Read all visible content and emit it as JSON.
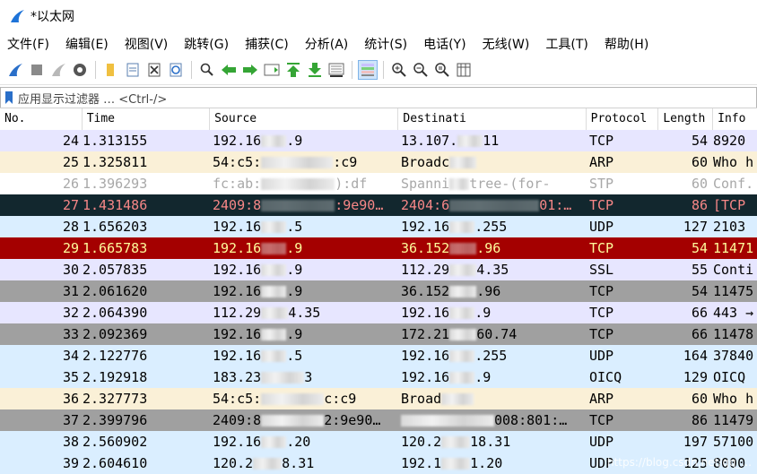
{
  "window": {
    "title": "*以太网"
  },
  "menu": [
    "文件(F)",
    "编辑(E)",
    "视图(V)",
    "跳转(G)",
    "捕获(C)",
    "分析(A)",
    "统计(S)",
    "电话(Y)",
    "无线(W)",
    "工具(T)",
    "帮助(H)"
  ],
  "filter": {
    "placeholder": "应用显示过滤器 … <Ctrl-/>"
  },
  "columns": {
    "no": "No.",
    "time": "Time",
    "source": "Source",
    "destination": "Destinati",
    "protocol": "Protocol",
    "length": "Length",
    "info": "Info"
  },
  "packets": [
    {
      "no": "24",
      "time": "1.313155",
      "src": "192.16",
      "src2": ".9",
      "dst": "13.107.",
      "dst2": "11",
      "proto": "TCP",
      "len": "54",
      "info": "8920"
    },
    {
      "no": "25",
      "time": "1.325811",
      "src": "54:c5:",
      "src2": ":c9",
      "dst": "Broadc",
      "dst2": "",
      "proto": "ARP",
      "len": "60",
      "info": "Who h"
    },
    {
      "no": "26",
      "time": "1.396293",
      "src": "fc:ab:",
      "src2": "):df",
      "dst": "Spanni",
      "dst2": "tree-(for-",
      "proto": "STP",
      "len": "60",
      "info": "Conf."
    },
    {
      "no": "27",
      "time": "1.431486",
      "src": "2409:8",
      "src2": ":9e90…",
      "dst": "2404:6",
      "dst2": "01:…",
      "proto": "TCP",
      "len": "86",
      "info": "[TCP"
    },
    {
      "no": "28",
      "time": "1.656203",
      "src": "192.16",
      "src2": ".5",
      "dst": "192.16",
      "dst2": ".255",
      "proto": "UDP",
      "len": "127",
      "info": "2103"
    },
    {
      "no": "29",
      "time": "1.665783",
      "src": "192.16",
      "src2": ".9",
      "dst": "36.152",
      "dst2": ".96",
      "proto": "TCP",
      "len": "54",
      "info": "11471"
    },
    {
      "no": "30",
      "time": "2.057835",
      "src": "192.16",
      "src2": ".9",
      "dst": "112.29",
      "dst2": "4.35",
      "proto": "SSL",
      "len": "55",
      "info": "Conti"
    },
    {
      "no": "31",
      "time": "2.061620",
      "src": "192.16",
      "src2": ".9",
      "dst": "36.152",
      "dst2": ".96",
      "proto": "TCP",
      "len": "54",
      "info": "11475"
    },
    {
      "no": "32",
      "time": "2.064390",
      "src": "112.29",
      "src2": "4.35",
      "dst": "192.16",
      "dst2": ".9",
      "proto": "TCP",
      "len": "66",
      "info": "443 →"
    },
    {
      "no": "33",
      "time": "2.092369",
      "src": "192.16",
      "src2": ".9",
      "dst": "172.21",
      "dst2": "60.74",
      "proto": "TCP",
      "len": "66",
      "info": "11478"
    },
    {
      "no": "34",
      "time": "2.122776",
      "src": "192.16",
      "src2": ".5",
      "dst": "192.16",
      "dst2": ".255",
      "proto": "UDP",
      "len": "164",
      "info": "37840"
    },
    {
      "no": "35",
      "time": "2.192918",
      "src": "183.23",
      "src2": "3",
      "dst": "192.16",
      "dst2": ".9",
      "proto": "OICQ",
      "len": "129",
      "info": "OICQ"
    },
    {
      "no": "36",
      "time": "2.327773",
      "src": "54:c5:",
      "src2": "c:c9",
      "dst": "Broad",
      "dst2": "",
      "proto": "ARP",
      "len": "60",
      "info": "Who h"
    },
    {
      "no": "37",
      "time": "2.399796",
      "src": "2409:8",
      "src2": "2:9e90…",
      "dst": "",
      "dst2": "008:801:…",
      "proto": "TCP",
      "len": "86",
      "info": "11479"
    },
    {
      "no": "38",
      "time": "2.560902",
      "src": "192.16",
      "src2": ".20",
      "dst": "120.2",
      "dst2": "18.31",
      "proto": "UDP",
      "len": "197",
      "info": "57100"
    },
    {
      "no": "39",
      "time": "2.604610",
      "src": "120.2",
      "src2": "8.31",
      "dst": "192.1",
      "dst2": "1.20",
      "proto": "UDP",
      "len": "125",
      "info": "8000"
    }
  ],
  "watermark": "https://blog.csdn.net/qq_..."
}
